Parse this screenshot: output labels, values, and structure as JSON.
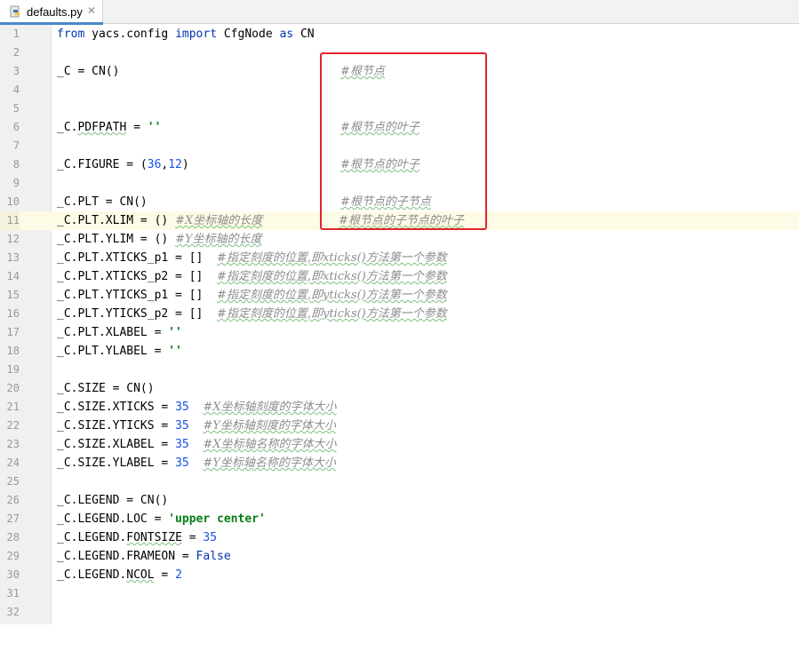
{
  "tab": {
    "filename": "defaults.py",
    "close_glyph": "✕",
    "icon": "python-file-icon"
  },
  "colors": {
    "keyword": "#0033b3",
    "number": "#1750eb",
    "string": "#067d17",
    "comment": "#8c8c8c",
    "highlight_box": "#e0252b",
    "tab_accent": "#4a88c7"
  },
  "lines": [
    {
      "n": "1"
    },
    {
      "n": "2"
    },
    {
      "n": "3"
    },
    {
      "n": "4"
    },
    {
      "n": "5"
    },
    {
      "n": "6"
    },
    {
      "n": "7"
    },
    {
      "n": "8"
    },
    {
      "n": "9"
    },
    {
      "n": "10"
    },
    {
      "n": "11"
    },
    {
      "n": "12"
    },
    {
      "n": "13"
    },
    {
      "n": "14"
    },
    {
      "n": "15"
    },
    {
      "n": "16"
    },
    {
      "n": "17"
    },
    {
      "n": "18"
    },
    {
      "n": "19"
    },
    {
      "n": "20"
    },
    {
      "n": "21"
    },
    {
      "n": "22"
    },
    {
      "n": "23"
    },
    {
      "n": "24"
    },
    {
      "n": "25"
    },
    {
      "n": "26"
    },
    {
      "n": "27"
    },
    {
      "n": "28"
    },
    {
      "n": "29"
    },
    {
      "n": "30"
    },
    {
      "n": "31"
    },
    {
      "n": "32"
    }
  ],
  "code": {
    "l1_from": "from",
    "l1_mod": " yacs.config ",
    "l1_import": "import",
    "l1_name": " CfgNode ",
    "l1_as": "as",
    "l1_alias": " CN",
    "l3": "_C = CN()",
    "l3_c": "#根节点",
    "l6_pre": "_C.",
    "l6_attr": "PDFPATH",
    "l6_eq": " = ",
    "l6_str": "''",
    "l6_c": "#根节点的叶子",
    "l8_pre": "_C.FIGURE = (",
    "l8_n1": "36",
    "l8_comma": ",",
    "l8_n2": "12",
    "l8_post": ")",
    "l8_c": "#根节点的叶子",
    "l10": "_C.PLT = CN()",
    "l10_c": "#根节点的子节点",
    "l11": "_C.PLT.XLIM = () ",
    "l11_c1": "#X坐标轴的长度",
    "l11_c2": "#根节点的子节点的叶子",
    "l12": "_C.PLT.YLIM = () ",
    "l12_c": "#Y坐标轴的长度",
    "l13": "_C.PLT.XTICKS_p1 = []  ",
    "l13_c": "#指定刻度的位置,即xticks()方法第一个参数",
    "l14": "_C.PLT.XTICKS_p2 = []  ",
    "l14_c": "#指定刻度的位置,即xticks()方法第一个参数",
    "l15": "_C.PLT.YTICKS_p1 = []  ",
    "l15_c": "#指定刻度的位置,即yticks()方法第一个参数",
    "l16": "_C.PLT.YTICKS_p2 = []  ",
    "l16_c": "#指定刻度的位置,即yticks()方法第一个参数",
    "l17": "_C.PLT.XLABEL = ",
    "l17_s": "''",
    "l18": "_C.PLT.YLABEL = ",
    "l18_s": "''",
    "l20": "_C.SIZE = CN()",
    "l21": "_C.SIZE.XTICKS = ",
    "l21_n": "35",
    "l21_c": "#X坐标轴刻度的字体大小",
    "l22": "_C.SIZE.YTICKS = ",
    "l22_n": "35",
    "l22_c": "#Y坐标轴刻度的字体大小",
    "l23": "_C.SIZE.XLABEL = ",
    "l23_n": "35",
    "l23_c": "#X坐标轴名称的字体大小",
    "l24": "_C.SIZE.YLABEL = ",
    "l24_n": "35",
    "l24_c": "#Y坐标轴名称的字体大小",
    "l26": "_C.LEGEND = CN()",
    "l27": "_C.LEGEND.LOC = ",
    "l27_s": "'upper center'",
    "l28_pre": "_C.LEGEND.",
    "l28_attr": "FONTSIZE",
    "l28_eq": " = ",
    "l28_n": "35",
    "l29": "_C.LEGEND.FRAMEON = ",
    "l29_b": "False",
    "l30_pre": "_C.LEGEND.",
    "l30_attr": "NCOL",
    "l30_eq": " = ",
    "l30_n": "2"
  }
}
